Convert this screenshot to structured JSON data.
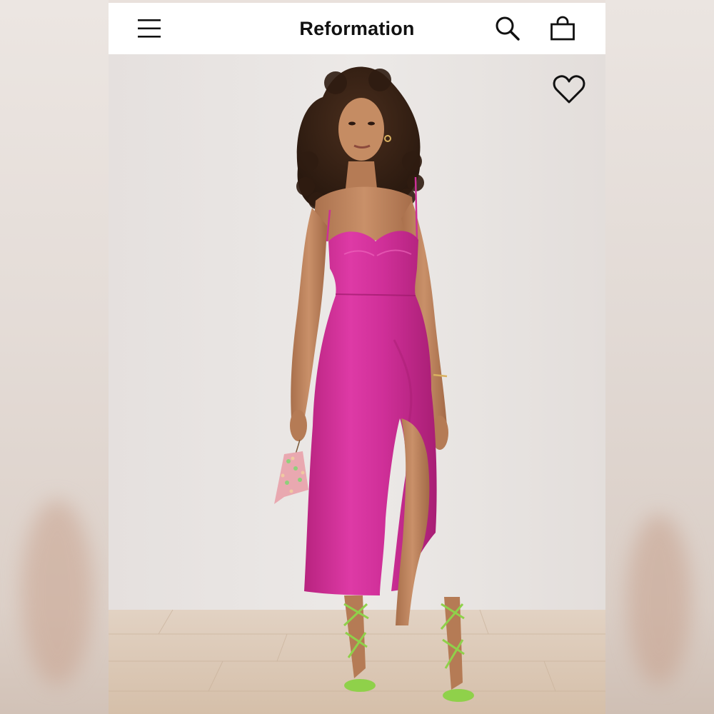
{
  "header": {
    "brand": "Reformation",
    "icons": {
      "menu": "hamburger-menu-icon",
      "search": "search-icon",
      "bag": "shopping-bag-icon",
      "wishlist": "heart-icon"
    }
  },
  "product_image": {
    "colors": {
      "wall": "#e7e3e1",
      "floor": "#d7c2ad",
      "dress": "#d12f9a",
      "sandals": "#8fd14a",
      "hair": "#3a2418",
      "skin": "#c48a62"
    }
  }
}
